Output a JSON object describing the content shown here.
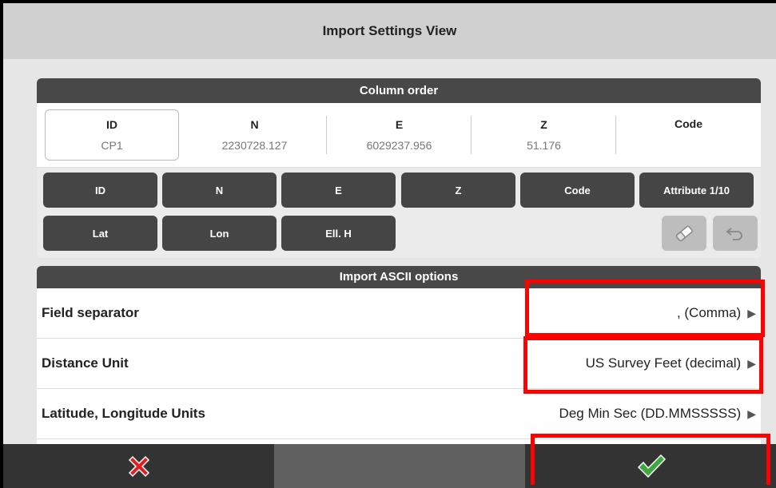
{
  "header": {
    "title": "Import Settings View"
  },
  "column_order": {
    "title": "Column order",
    "columns": [
      {
        "header": "ID",
        "value": "CP1"
      },
      {
        "header": "N",
        "value": "2230728.127"
      },
      {
        "header": "E",
        "value": "6029237.956"
      },
      {
        "header": "Z",
        "value": "51.176"
      },
      {
        "header": "Code",
        "value": ""
      }
    ],
    "field_buttons_row1": [
      "ID",
      "N",
      "E",
      "Z",
      "Code",
      "Attribute 1/10"
    ],
    "field_buttons_row2": [
      "Lat",
      "Lon",
      "Ell. H"
    ],
    "icons": [
      "eraser-icon",
      "undo-icon"
    ]
  },
  "ascii_options": {
    "title": "Import ASCII options",
    "rows": [
      {
        "label": "Field separator",
        "value": ", (Comma)"
      },
      {
        "label": "Distance Unit",
        "value": "US Survey Feet (decimal)"
      },
      {
        "label": "Latitude, Longitude Units",
        "value": "Deg Min Sec (DD.MMSSSSS)"
      }
    ]
  },
  "footer": {
    "cancel_icon": "cancel-x-icon",
    "confirm_icon": "confirm-check-icon"
  },
  "colors": {
    "dark_button": "#454545",
    "highlight": "#ff0000",
    "cancel": "#e02020",
    "confirm": "#3ea83e"
  }
}
